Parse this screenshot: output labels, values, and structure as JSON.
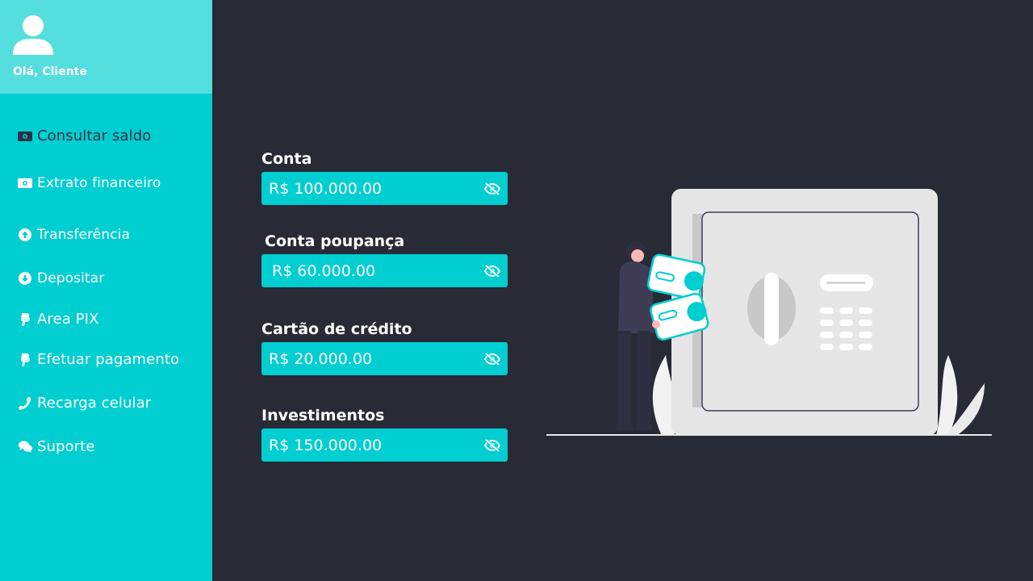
{
  "sidebar": {
    "greeting": "Olá, Cliente",
    "items": [
      {
        "label": "Consultar saldo",
        "icon": "money-bill-icon",
        "active": true
      },
      {
        "label": "Extrato financeiro",
        "icon": "money-bill-icon"
      },
      {
        "label": "Transferência",
        "icon": "arrow-circle-up-icon"
      },
      {
        "label": "Depositar",
        "icon": "arrow-circle-down-icon"
      },
      {
        "label": "Area PIX",
        "icon": "paypal-icon"
      },
      {
        "label": "Efetuar pagamento",
        "icon": "paypal-icon"
      },
      {
        "label": "Recarga celular",
        "icon": "phone-icon"
      },
      {
        "label": "Suporte",
        "icon": "comments-icon"
      }
    ]
  },
  "accounts": [
    {
      "label": "Conta",
      "value": "R$ 100.000.00"
    },
    {
      "label": "Conta poupança",
      "value": "R$ 60.000.00"
    },
    {
      "label": "Cartão de crédito",
      "value": "R$ 20.000.00"
    },
    {
      "label": "Investimentos",
      "value": "R$ 150.000.00"
    }
  ],
  "colors": {
    "sidebar": "#00ced1",
    "sidebar_header": "#55dede",
    "background": "#282a36",
    "active_text": "#233449"
  }
}
